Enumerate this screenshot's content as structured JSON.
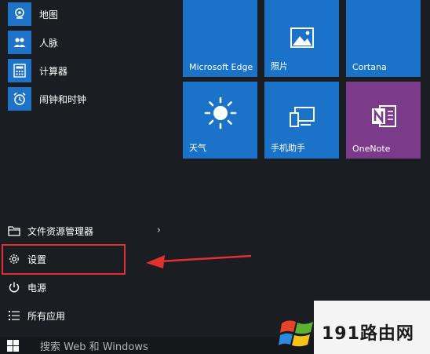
{
  "apps": [
    {
      "label": "地图",
      "icon": "maps-icon"
    },
    {
      "label": "人脉",
      "icon": "people-icon"
    },
    {
      "label": "计算器",
      "icon": "calculator-icon"
    },
    {
      "label": "闹钟和时钟",
      "icon": "alarm-clock-icon"
    }
  ],
  "system": {
    "explorer": {
      "label": "文件资源管理器",
      "icon": "folder-icon"
    },
    "settings": {
      "label": "设置",
      "icon": "gear-icon"
    },
    "power": {
      "label": "电源",
      "icon": "power-icon"
    },
    "all_apps": {
      "label": "所有应用",
      "icon": "list-icon"
    }
  },
  "tiles": [
    {
      "label": "Microsoft Edge",
      "icon": "edge-icon"
    },
    {
      "label": "照片",
      "icon": "photos-icon"
    },
    {
      "label": "Cortana",
      "icon": "cortana-icon"
    },
    {
      "label": "天气",
      "icon": "weather-sun-icon"
    },
    {
      "label": "手机助手",
      "icon": "phone-companion-icon"
    },
    {
      "label": "OneNote",
      "icon": "onenote-icon"
    }
  ],
  "taskbar": {
    "search_placeholder": "搜索 Web 和 Windows"
  },
  "watermark": {
    "text": "191路由网"
  },
  "colors": {
    "tile_blue": "#1a72c9",
    "onenote_purple": "#7c3a8b",
    "highlight_red": "#e0302f",
    "background": "#1a1d22"
  }
}
